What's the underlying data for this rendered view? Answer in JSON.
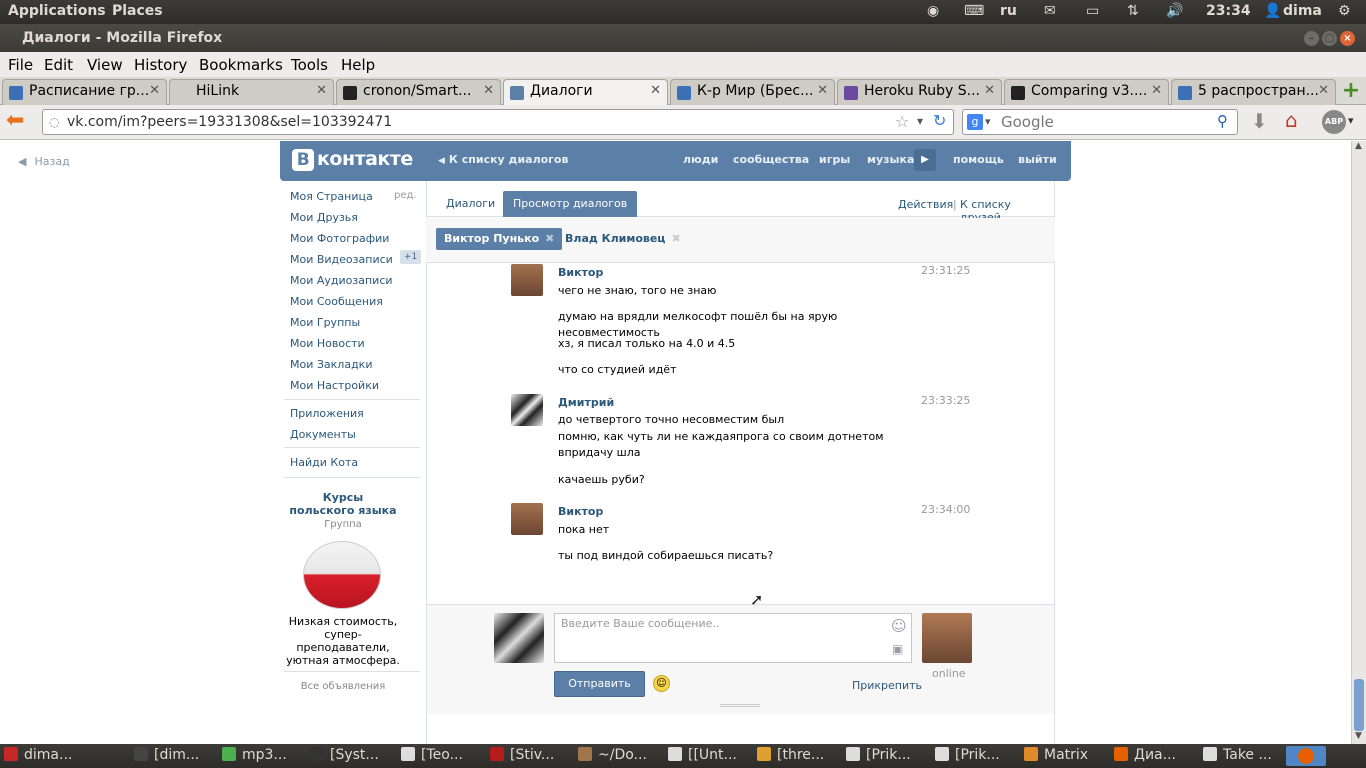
{
  "top_panel": {
    "applications": "Applications",
    "places": "Places",
    "lang": "ru",
    "time": "23:34",
    "user": "dima"
  },
  "window": {
    "title": "Диалоги - Mozilla Firefox"
  },
  "menubar": [
    "File",
    "Edit",
    "View",
    "History",
    "Bookmarks",
    "Tools",
    "Help"
  ],
  "tabs": [
    {
      "label": "Расписание гр...",
      "color": "#3b6fb6"
    },
    {
      "label": "HiLink",
      "color": "#cfccc6"
    },
    {
      "label": "cronon/Smart...",
      "color": "#222222"
    },
    {
      "label": "Диалоги",
      "color": "#5b7fa6"
    },
    {
      "label": "К-р Мир (Брес...",
      "color": "#3b6fb6"
    },
    {
      "label": "Heroku Ruby S...",
      "color": "#6c4aa0"
    },
    {
      "label": "Comparing v3....",
      "color": "#222222"
    },
    {
      "label": "5 распростран...",
      "color": "#3b6fb6"
    }
  ],
  "nav": {
    "url": "vk.com/im?peers=19331308&sel=103392471",
    "search_placeholder": "Google"
  },
  "vk": {
    "back": "Назад",
    "logo_b": "В",
    "logo_text": "контакте",
    "to_list": "К списку диалогов",
    "head_links": [
      "люди",
      "сообщества",
      "игры",
      "музыка",
      "помощь",
      "выйти"
    ],
    "left_menu": [
      "Моя Страница",
      "Мои Друзья",
      "Мои Фотографии",
      "Мои Видеозаписи",
      "Мои Аудиозаписи",
      "Мои Сообщения",
      "Мои Группы",
      "Мои Новости",
      "Мои Закладки",
      "Мои Настройки"
    ],
    "edit": "ред.",
    "video_badge": "+1",
    "left_menu2": [
      "Приложения",
      "Документы"
    ],
    "find_cat": "Найди Кота",
    "ad": {
      "title": "Курсы польского языка",
      "type": "Группа",
      "text": "Низкая стоимость, супер-преподаватели, уютная атмосфера.",
      "all_ads": "Все объявления"
    },
    "view_tabs": [
      "Диалоги",
      "Просмотр диалогов"
    ],
    "actions": "Действия",
    "sep": "|",
    "friends_list": "К списку друзей",
    "peers": [
      "Виктор Пунько",
      "Влад Климовец"
    ],
    "messages": [
      {
        "name": "Виктор",
        "time": "23:31:25",
        "lines": [
          "чего не знаю, того не знаю",
          "думаю на врядли мелкософт пошёл бы на ярую несовместимость",
          "хз, я писал только на 4.0 и 4.5",
          "что со студией идёт"
        ]
      },
      {
        "name": "Дмитрий",
        "time": "23:33:25",
        "lines": [
          "до четвертого точно несовместим был",
          "помню, как чуть ли не каждаяпрога со своим дотнетом впридачу шла",
          "качаешь руби?"
        ]
      },
      {
        "name": "Виктор",
        "time": "23:34:00",
        "lines": [
          "пока нет",
          "ты под виндой собираешься писать?"
        ]
      }
    ],
    "composer": {
      "placeholder": "Введите Ваше сообщение..",
      "send": "Отправить",
      "attach": "Прикрепить",
      "online": "online"
    }
  },
  "taskbar": [
    {
      "label": "dima...",
      "color": "#c62828"
    },
    {
      "label": "[dim...",
      "color": "#444444"
    },
    {
      "label": "mp3...",
      "color": "#4caf50"
    },
    {
      "label": "[Syst...",
      "color": "#333333"
    },
    {
      "label": "[Teo...",
      "color": "#dddddd"
    },
    {
      "label": "[Stiv...",
      "color": "#b71c1c"
    },
    {
      "label": "~/Do...",
      "color": "#a0764a"
    },
    {
      "label": "[[Unt...",
      "color": "#dddddd"
    },
    {
      "label": "[thre...",
      "color": "#e0a030"
    },
    {
      "label": "[Prik...",
      "color": "#dddddd"
    },
    {
      "label": "[Prik...",
      "color": "#dddddd"
    },
    {
      "label": "Matrix",
      "color": "#e08a2a"
    },
    {
      "label": "Диа...",
      "color": "#e66000"
    },
    {
      "label": "Take ...",
      "color": "#dddddd"
    }
  ]
}
